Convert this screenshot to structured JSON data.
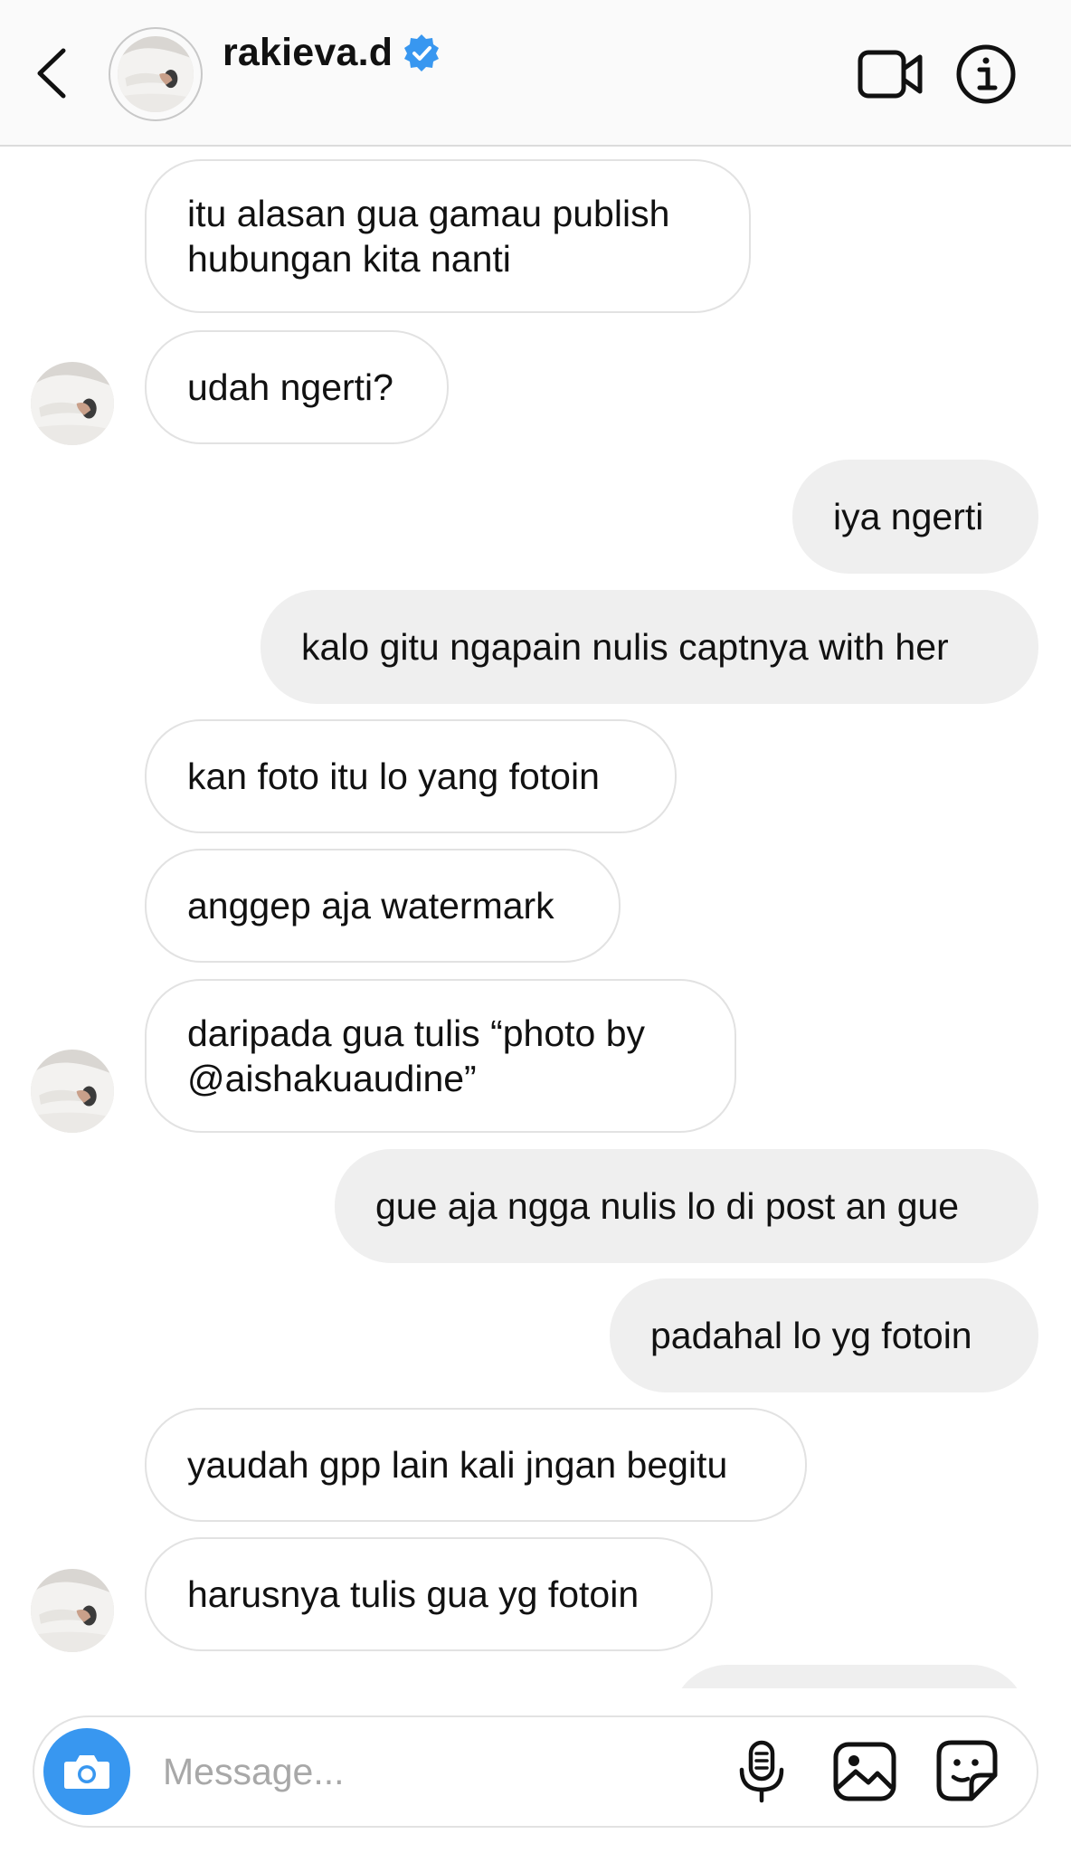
{
  "header": {
    "username": "rakieva.d",
    "verified": true,
    "icons": {
      "back": "chevron-left-icon",
      "verified": "verified-badge-icon",
      "video": "video-call-icon",
      "info": "info-icon"
    }
  },
  "messages": [
    {
      "side": "received",
      "text": "itu alasan gua gamau publish hubungan kita nanti"
    },
    {
      "side": "received",
      "text": "udah ngerti?"
    },
    {
      "side": "sent",
      "text": "iya ngerti"
    },
    {
      "side": "sent",
      "text": "kalo gitu ngapain nulis captnya with her"
    },
    {
      "side": "received",
      "text": "kan foto itu lo yang fotoin"
    },
    {
      "side": "received",
      "text": "anggep aja watermark"
    },
    {
      "side": "received",
      "text": "daripada gua tulis “photo by @aishakuaudine”"
    },
    {
      "side": "sent",
      "text": "gue aja ngga nulis lo di post an gue"
    },
    {
      "side": "sent",
      "text": "padahal lo yg fotoin"
    },
    {
      "side": "received",
      "text": "yaudah gpp lain kali jngan begitu"
    },
    {
      "side": "received",
      "text": "harusnya tulis gua yg fotoin"
    }
  ],
  "composer": {
    "placeholder": "Message...",
    "icons": {
      "camera": "camera-icon",
      "mic": "microphone-icon",
      "gallery": "image-gallery-icon",
      "sticker": "sticker-icon"
    }
  },
  "colors": {
    "camera_button": "#3897f0",
    "verified_badge": "#3897f0",
    "sent_bubble": "#efefef",
    "received_border": "#e2e2e2",
    "placeholder": "#a8a8a8"
  }
}
